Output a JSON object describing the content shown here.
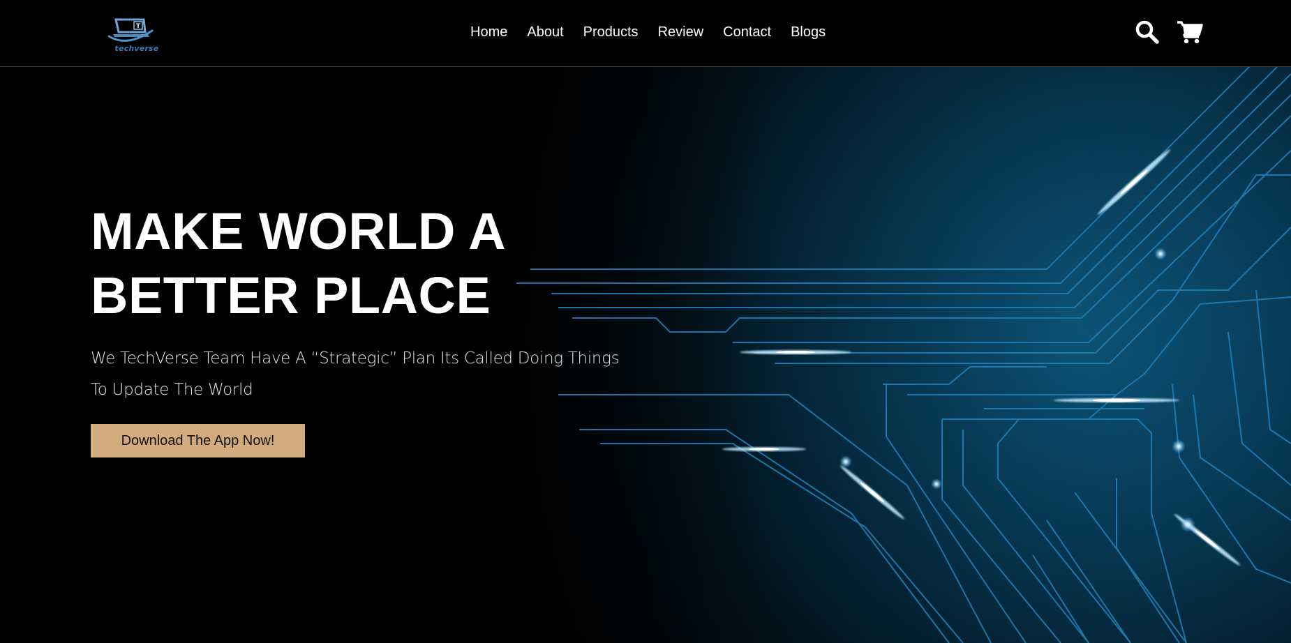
{
  "header": {
    "logo_text": "techverse",
    "nav": [
      {
        "label": "Home"
      },
      {
        "label": "About"
      },
      {
        "label": "Products"
      },
      {
        "label": "Review"
      },
      {
        "label": "Contact"
      },
      {
        "label": "Blogs"
      }
    ],
    "icons": [
      "search-icon",
      "cart-icon"
    ]
  },
  "hero": {
    "title_line1": "MAKE WORLD A",
    "title_line2": "BETTER PLACE",
    "subtitle_line1": "We TechVerse Team Have A “Strategic” Plan Its Called Doing Things",
    "subtitle_line2": "To Update The World",
    "cta_label": "Download The App Now!"
  },
  "colors": {
    "background": "#000000",
    "accent_button": "#d2ab7e",
    "circuit_blue": "#1f86c2",
    "logo_blue": "#3d7bb8"
  }
}
